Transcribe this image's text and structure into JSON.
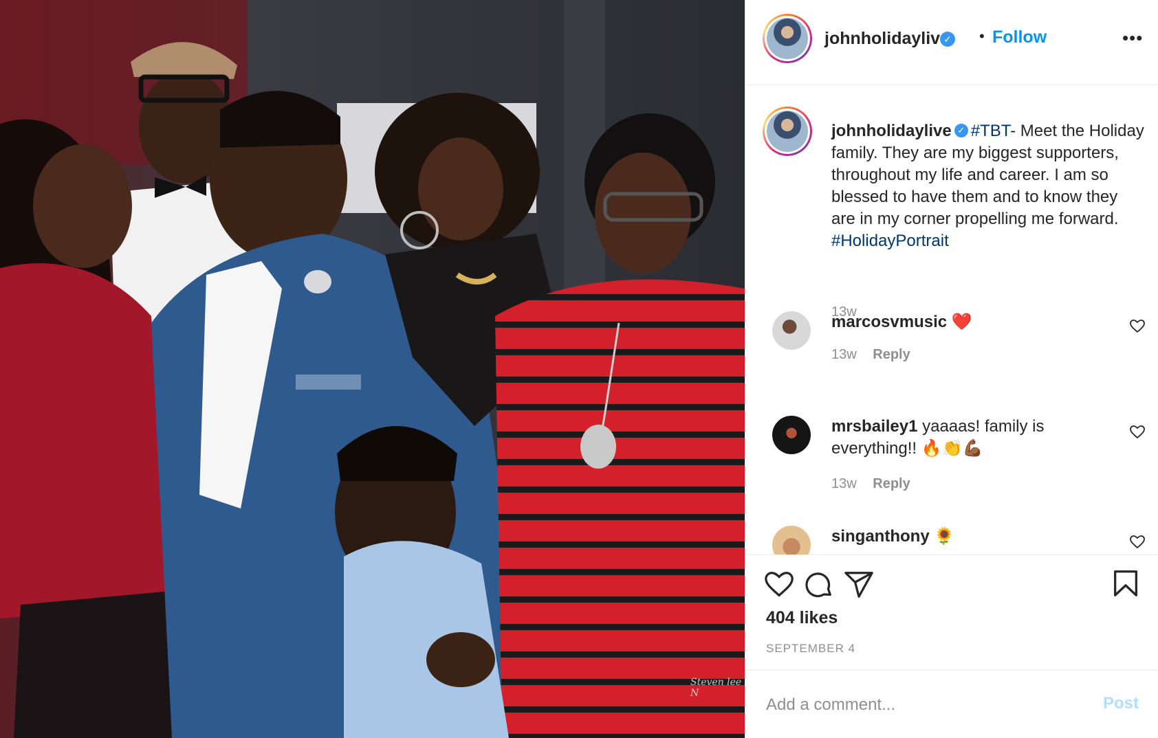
{
  "header": {
    "username": "johnholidaylive",
    "verified_glyph": "✓",
    "separator": "•",
    "follow_label": "Follow",
    "more_label": "•••"
  },
  "caption": {
    "username": "johnholidaylive",
    "hashtag1": "#TBT",
    "text": "- Meet the Holiday family. They are my biggest supporters, throughout my life and career. I am so blessed to have them and to know they are in my corner propelling me forward.",
    "hashtag2": "#HolidayPortrait",
    "time": "13w"
  },
  "comments": [
    {
      "username": "marcosvmusic",
      "text": "❤️",
      "time": "13w",
      "reply": "Reply"
    },
    {
      "username": "mrsbailey1",
      "text": "yaaaas! family is everything!! 🔥👏💪🏾",
      "time": "13w",
      "reply": "Reply"
    },
    {
      "username": "singanthony",
      "text": "🌻"
    }
  ],
  "actions": {
    "likes": "404 likes",
    "date": "SEPTEMBER 4"
  },
  "add_comment": {
    "placeholder": "Add a comment...",
    "post_label": "Post"
  },
  "photo": {
    "credit": "Steven lee N"
  },
  "colors": {
    "accent": "#0095f6",
    "verified": "#3897f0",
    "hashtag": "#00376b",
    "muted": "#8e8e8e"
  },
  "icons": [
    "verified-icon",
    "more-icon",
    "heart-icon",
    "comment-icon",
    "share-icon",
    "bookmark-icon"
  ]
}
